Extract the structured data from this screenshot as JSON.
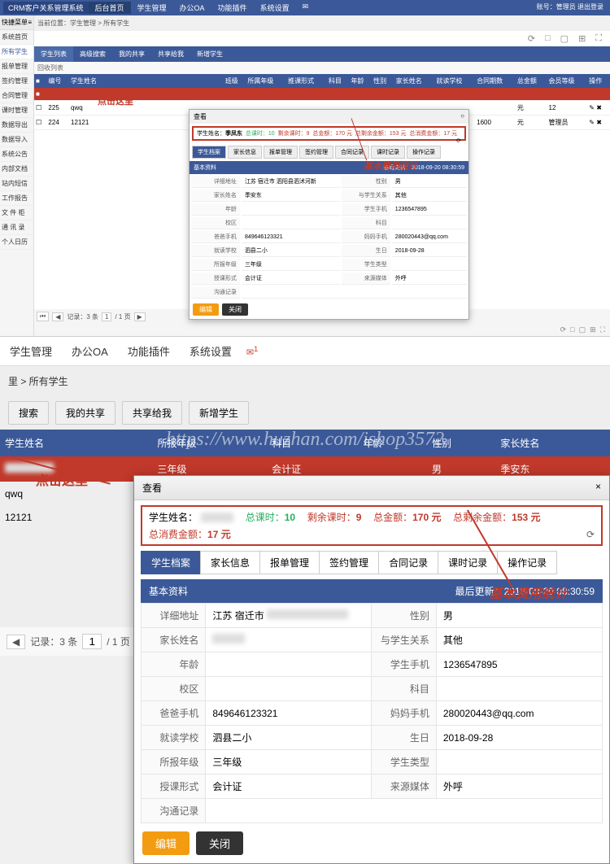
{
  "top": {
    "brand": "CRM客户关系管理系统",
    "nav": [
      "后台首页",
      "学生管理",
      "办公OA",
      "功能插件",
      "系统设置"
    ],
    "user_label": "账号：管理员 退出登录",
    "sidebar_title": "快捷菜单",
    "sidebar": [
      "系统首页",
      "所有学生",
      "报单管理",
      "签约管理",
      "合同管理",
      "课时管理",
      "数据导出",
      "数据导入",
      "系统公告",
      "内部文档",
      "站内短信",
      "工作报告",
      "文 件 柜",
      "通 讯 录",
      "个人日历"
    ],
    "breadcrumb": "当前位置：学生管理 > 所有学生",
    "tabs": [
      "学生列表",
      "高级搜索",
      "我的共享",
      "共享给我",
      "新增学生"
    ],
    "toolbar": "回收列表",
    "cols": [
      "",
      "编号",
      "学生姓名",
      "",
      "班级",
      "所属年级",
      "推课形式",
      "科目",
      "年龄",
      "性别",
      "家长姓名",
      "就读学校",
      "合同期数",
      "总金额",
      "会员等级",
      "操作"
    ],
    "rows": [
      {
        "n": "",
        "name": "",
        "hl": true
      },
      {
        "n": "225",
        "name": "qwq",
        "unit": "元",
        "level": "12"
      },
      {
        "n": "224",
        "name": "12121",
        "unit": "元",
        "amt": "1600",
        "level": "管理员"
      }
    ],
    "pager": {
      "records": "记录：3 条",
      "page": "1",
      "pages": "/ 1 页"
    }
  },
  "bottom": {
    "nav": [
      "学生管理",
      "办公OA",
      "功能插件",
      "系统设置"
    ],
    "mail_badge": "1",
    "breadcrumb": "里 > 所有学生",
    "btns": [
      "搜索",
      "我的共享",
      "共享给我",
      "新增学生"
    ],
    "cols": [
      "学生姓名",
      "所报年级",
      "科目",
      "年龄",
      "性别",
      "家长姓名"
    ],
    "rows": [
      {
        "name": "",
        "grade": "三年级",
        "subj": "会计证",
        "gender": "男",
        "parent": "季安东",
        "hl": true
      },
      {
        "name": "qwq"
      },
      {
        "name": "12121"
      }
    ],
    "pager": {
      "records": "记录：3 条",
      "page": "1",
      "pages": "/ 1 页"
    }
  },
  "anno": {
    "click_here": "点击这里",
    "fee_stats": "基本费用统计"
  },
  "modal": {
    "title": "查看",
    "sum": {
      "name_label": "学生姓名：",
      "name_value": "季凤东",
      "lessons_label": "总课时：",
      "lessons": "10",
      "remain_lessons_label": "剩余课时：",
      "remain_lessons": "9",
      "amount_label": "总金额：",
      "amount": "170 元",
      "remain_amount_label": "总剩余金额：",
      "remain_amount": "153 元",
      "spent_label": "总消费金额：",
      "spent": "17 元"
    },
    "tabs": [
      "学生档案",
      "家长信息",
      "报单管理",
      "签约管理",
      "合同记录",
      "课时记录",
      "操作记录"
    ],
    "section": "基本资料",
    "updated_label": "最后更新：",
    "updated": "2018-09-20 08:30:59",
    "kv": [
      [
        "详细地址",
        "江苏 宿迁市 泗阳县泗沭河新",
        "性别",
        "男"
      ],
      [
        "家长姓名",
        "季安东",
        "与学生关系",
        "其他"
      ],
      [
        "年龄",
        "",
        "学生手机",
        "1236547895"
      ],
      [
        "校区",
        "",
        "科目",
        ""
      ],
      [
        "爸爸手机",
        "849646123321",
        "妈妈手机",
        "280020443@qq.com"
      ],
      [
        "就读学校",
        "泗县二小",
        "生日",
        "2018-09-28"
      ],
      [
        "所报年级",
        "三年级",
        "学生类型",
        ""
      ],
      [
        "授课形式",
        "会计证",
        "来源媒体",
        "外呼"
      ],
      [
        "沟通记录",
        "",
        "",
        ""
      ]
    ],
    "btn_edit": "编辑",
    "btn_close": "关闭"
  },
  "watermark": "https://www.huzhan.com/ishop3572"
}
